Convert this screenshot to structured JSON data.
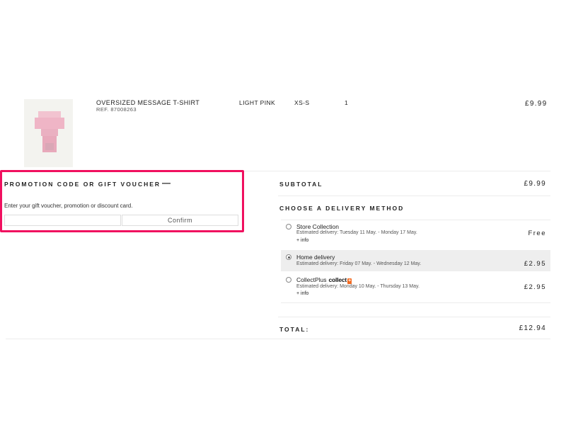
{
  "product": {
    "name": "OVERSIZED MESSAGE T-SHIRT",
    "ref": "REF. 87008263",
    "color": "LIGHT PINK",
    "size": "XS-S",
    "quantity": "1",
    "price": "£9.99",
    "thumb_color": "#f1c6d2"
  },
  "promo": {
    "title": "PROMOTION CODE OR GIFT VOUCHER",
    "toggle": "—",
    "hint": "Enter your gift voucher, promotion or discount card.",
    "input_value": "",
    "confirm_label": "Confirm",
    "highlight_color": "#f0105f"
  },
  "summary": {
    "subtotal_label": "SUBTOTAL",
    "subtotal_value": "£9.99",
    "delivery_heading": "CHOOSE A DELIVERY METHOD",
    "options": [
      {
        "name": "Store Collection",
        "estimate": "Estimated delivery: Tuesday 11 May. - Monday 17 May.",
        "info": "+ info",
        "price": "Free",
        "selected": false
      },
      {
        "name": "Home delivery",
        "estimate": "Estimated delivery: Friday 07 May. - Wednesday 12 May.",
        "info": "",
        "price": "£2.95",
        "selected": true
      },
      {
        "name": "CollectPlus",
        "logo_text": "collect",
        "logo_plus": "+",
        "estimate": "Estimated delivery: Monday 10 May. - Thursday 13 May.",
        "info": "+ info",
        "price": "£2.95",
        "selected": false
      }
    ],
    "total_label": "TOTAL:",
    "total_value": "£12.94"
  }
}
